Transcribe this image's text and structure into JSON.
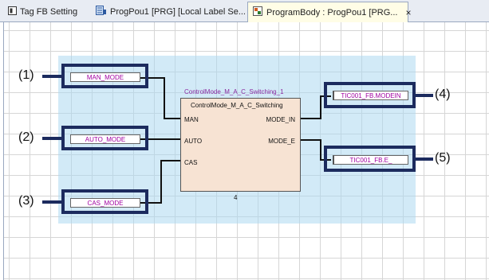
{
  "tabs": [
    {
      "label": "Tag FB Setting"
    },
    {
      "label": "ProgPou1 [PRG] [Local Label Se..."
    },
    {
      "label": "ProgramBody : ProgPou1 [PRG...",
      "close": "×"
    }
  ],
  "fb": {
    "instance": "ControlMode_M_A_C_Switching_1",
    "type": "ControlMode_M_A_C_Switching",
    "inputs": [
      "MAN",
      "AUTO",
      "CAS"
    ],
    "outputs": [
      "MODE_IN",
      "MODE_E"
    ],
    "step_number": "4"
  },
  "variables": {
    "man_mode": "MAN_MODE",
    "auto_mode": "AUTO_MODE",
    "cas_mode": "CAS_MODE",
    "modein": "TIC001_FB.MODEIN",
    "fbe": "TIC001_FB.E_"
  },
  "callouts": [
    "(1)",
    "(2)",
    "(3)",
    "(4)",
    "(5)"
  ],
  "colors": {
    "highlight": "#1c2b5e",
    "fb_body": "#f7e3d3",
    "variable_text": "#a000a0",
    "selection_area": "#add8f0"
  },
  "icons": {
    "tab1": "tag-fb-setting-icon",
    "tab2": "local-label-icon",
    "tab3": "program-body-icon"
  }
}
